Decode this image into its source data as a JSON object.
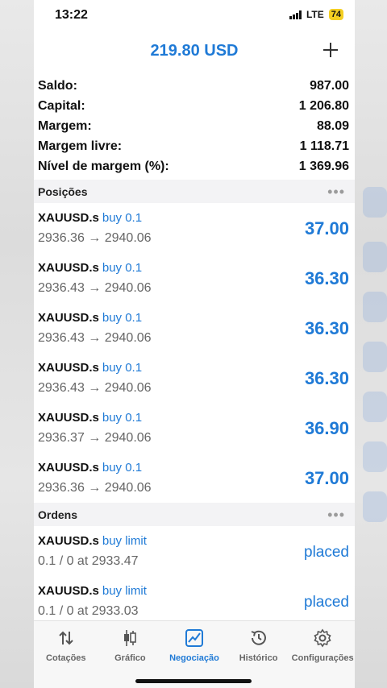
{
  "status_bar": {
    "time": "13:22",
    "network": "LTE",
    "battery": "74"
  },
  "header": {
    "balance": "219.80 USD",
    "add_label": "+"
  },
  "summary": [
    {
      "label": "Saldo:",
      "value": "987.00"
    },
    {
      "label": "Capital:",
      "value": "1 206.80"
    },
    {
      "label": "Margem:",
      "value": "88.09"
    },
    {
      "label": "Margem livre:",
      "value": "1 118.71"
    },
    {
      "label": "Nível de margem (%):",
      "value": "1 369.96"
    }
  ],
  "positions": {
    "title": "Posições",
    "more": "•••",
    "items": [
      {
        "symbol": "XAUUSD.s",
        "dir": "buy 0.1",
        "prices": "2936.36 → 2940.06",
        "profit": "37.00"
      },
      {
        "symbol": "XAUUSD.s",
        "dir": "buy 0.1",
        "prices": "2936.43 → 2940.06",
        "profit": "36.30"
      },
      {
        "symbol": "XAUUSD.s",
        "dir": "buy 0.1",
        "prices": "2936.43 → 2940.06",
        "profit": "36.30"
      },
      {
        "symbol": "XAUUSD.s",
        "dir": "buy 0.1",
        "prices": "2936.43 → 2940.06",
        "profit": "36.30"
      },
      {
        "symbol": "XAUUSD.s",
        "dir": "buy 0.1",
        "prices": "2936.37 → 2940.06",
        "profit": "36.90"
      },
      {
        "symbol": "XAUUSD.s",
        "dir": "buy 0.1",
        "prices": "2936.36 → 2940.06",
        "profit": "37.00"
      }
    ]
  },
  "orders": {
    "title": "Ordens",
    "more": "•••",
    "items": [
      {
        "symbol": "XAUUSD.s",
        "dir": "buy limit",
        "details": "0.1 / 0 at 2933.47",
        "status": "placed"
      },
      {
        "symbol": "XAUUSD.s",
        "dir": "buy limit",
        "details": "0.1 / 0 at 2933.03",
        "status": "placed"
      }
    ]
  },
  "tabbar": [
    {
      "label": "Cotações",
      "icon": "quotes-arrows-icon",
      "active": false
    },
    {
      "label": "Gráfico",
      "icon": "candlestick-chart-icon",
      "active": false
    },
    {
      "label": "Negociação",
      "icon": "trade-chart-icon",
      "active": true
    },
    {
      "label": "Histórico",
      "icon": "history-clock-icon",
      "active": false
    },
    {
      "label": "Configurações",
      "icon": "gear-icon",
      "active": false
    }
  ],
  "colors": {
    "accent": "#1f7ad6",
    "battery": "#f4cf22"
  }
}
